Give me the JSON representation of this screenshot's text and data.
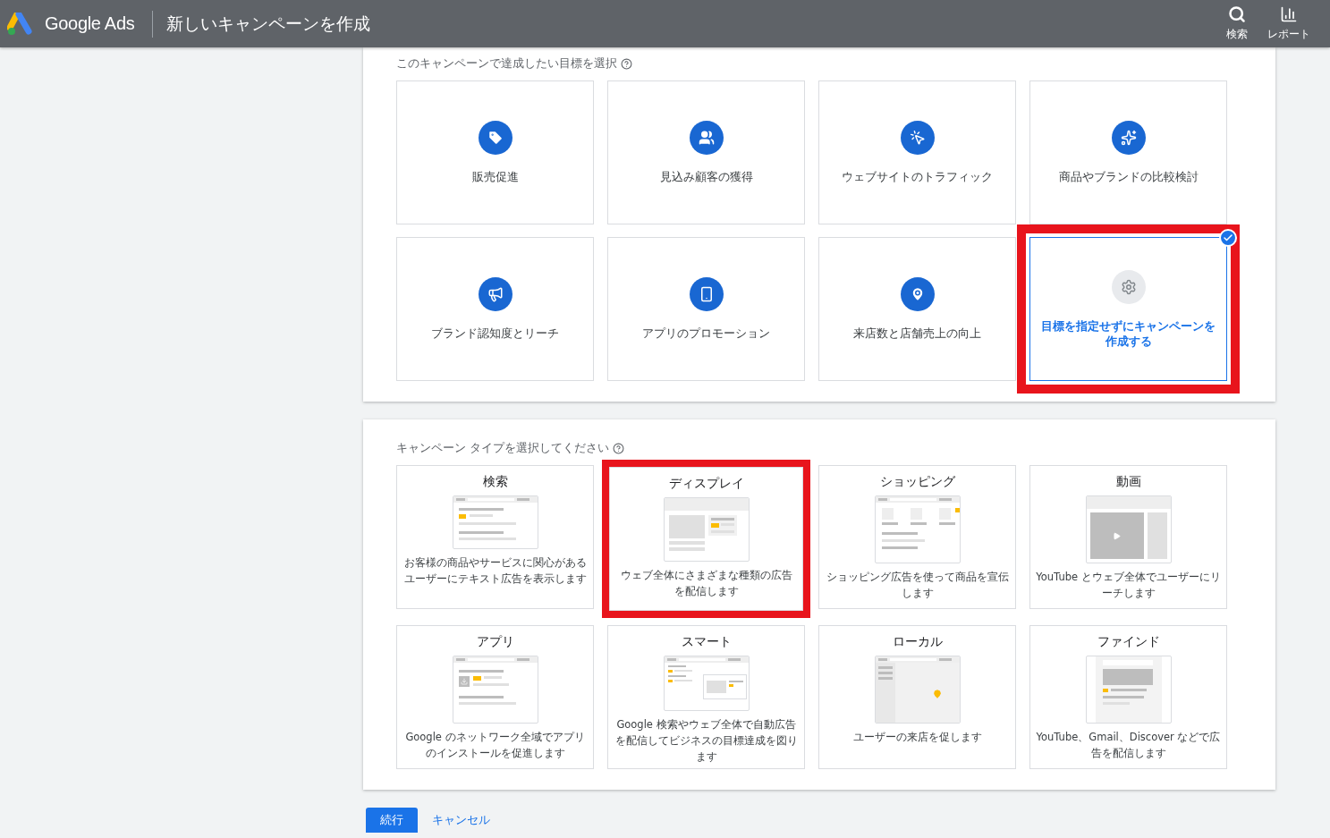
{
  "header": {
    "logo_text": "Google Ads",
    "title": "新しいキャンペーンを作成",
    "actions": [
      {
        "kind": "search",
        "label": "検索"
      },
      {
        "kind": "report",
        "label": "レポート"
      }
    ]
  },
  "goals": {
    "heading": "このキャンペーンで達成したい目標を選択",
    "items": [
      {
        "kind": "sales",
        "label": "販売促進",
        "selected": false,
        "highlighted": false
      },
      {
        "kind": "leads",
        "label": "見込み顧客の獲得",
        "selected": false,
        "highlighted": false
      },
      {
        "kind": "traffic",
        "label": "ウェブサイトのトラフィック",
        "selected": false,
        "highlighted": false
      },
      {
        "kind": "consideration",
        "label": "商品やブランドの比較検討",
        "selected": false,
        "highlighted": false
      },
      {
        "kind": "awareness",
        "label": "ブランド認知度とリーチ",
        "selected": false,
        "highlighted": false
      },
      {
        "kind": "app",
        "label": "アプリのプロモーション",
        "selected": false,
        "highlighted": false
      },
      {
        "kind": "store",
        "label": "来店数と店舗売上の向上",
        "selected": false,
        "highlighted": false
      },
      {
        "kind": "none",
        "label": "目標を指定せずにキャンペーンを作成する",
        "selected": true,
        "highlighted": true
      }
    ]
  },
  "campaign_types": {
    "heading": "キャンペーン タイプを選択してください",
    "items": [
      {
        "kind": "search",
        "title": "検索",
        "description": "お客様の商品やサービスに関心があるユーザーにテキスト広告を表示します",
        "highlighted": false
      },
      {
        "kind": "display",
        "title": "ディスプレイ",
        "description": "ウェブ全体にさまざまな種類の広告を配信します",
        "highlighted": true
      },
      {
        "kind": "shopping",
        "title": "ショッピング",
        "description": "ショッピング広告を使って商品を宣伝します",
        "highlighted": false
      },
      {
        "kind": "video",
        "title": "動画",
        "description": "YouTube とウェブ全体でユーザーにリーチします",
        "highlighted": false
      },
      {
        "kind": "app",
        "title": "アプリ",
        "description": "Google のネットワーク全域でアプリのインストールを促進します",
        "highlighted": false
      },
      {
        "kind": "smart",
        "title": "スマート",
        "description": "Google 検索やウェブ全体で自動広告を配信してビジネスの目標達成を図ります",
        "highlighted": false
      },
      {
        "kind": "local",
        "title": "ローカル",
        "description": "ユーザーの来店を促します",
        "highlighted": false
      },
      {
        "kind": "discovery",
        "title": "ファインド",
        "description": "YouTube、Gmail、Discover などで広告を配信します",
        "highlighted": false
      }
    ]
  },
  "buttons": {
    "continue": "続行",
    "cancel": "キャンセル"
  }
}
